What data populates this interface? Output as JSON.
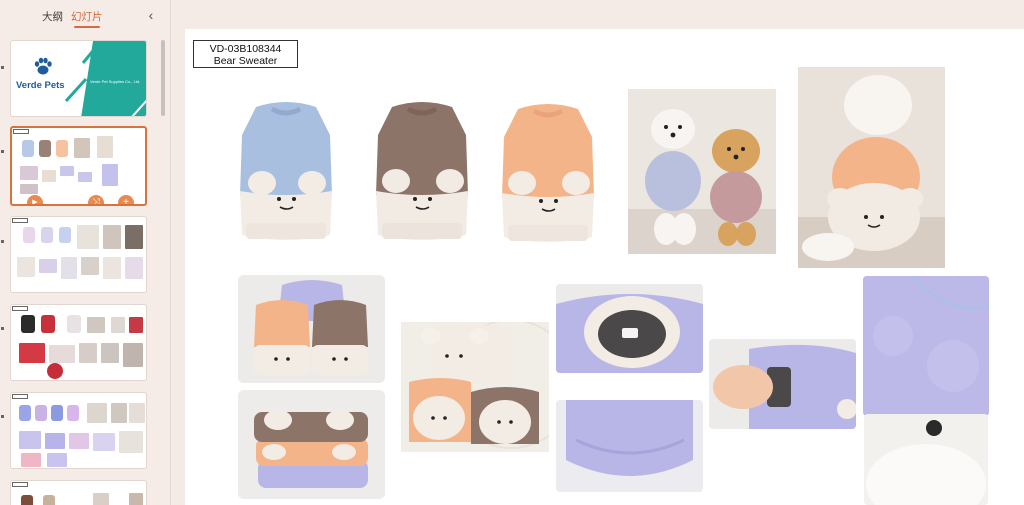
{
  "panel": {
    "tabs": [
      {
        "label": "大纲"
      },
      {
        "label": "幻灯片"
      }
    ],
    "collapse_icon": "chevron-left-icon"
  },
  "thumbnails": {
    "slide1_logo": "Verde Pets",
    "slide1_company": "Verde Pet Supplies Co., Ltd.",
    "tool_icons": [
      "play-icon",
      "shuffle-icon",
      "plus-icon"
    ]
  },
  "product": {
    "code": "VD-03B108344",
    "name": "Bear Sweater"
  },
  "colors": {
    "accent": "#d9733e",
    "teal": "#23a99b",
    "blue_sweater": "#a9bfe0",
    "brown_sweater": "#8d7468",
    "peach_sweater": "#f4b48a",
    "lavender": "#b8b6e6",
    "cream": "#f3ece5"
  }
}
